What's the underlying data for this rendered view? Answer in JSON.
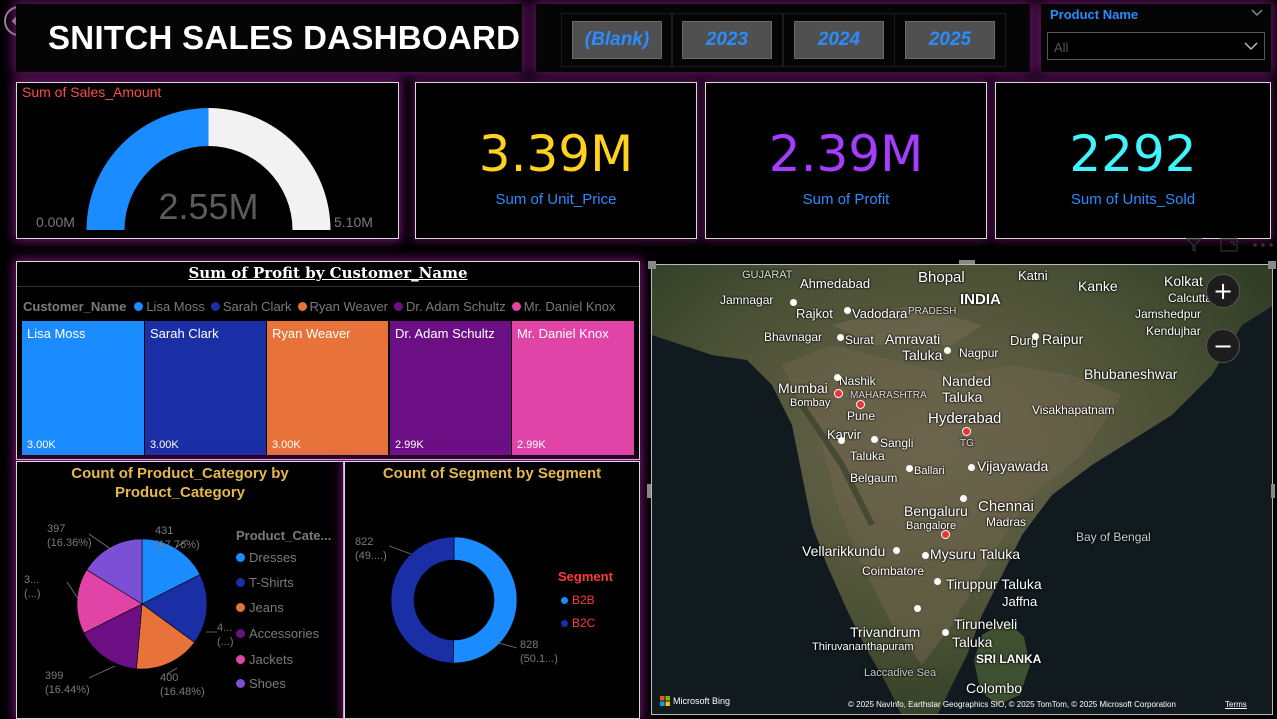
{
  "header": {
    "title": "SNITCH SALES DASHBOARD"
  },
  "year_slicer": {
    "options": [
      "(Blank)",
      "2023",
      "2024",
      "2025"
    ]
  },
  "product_slicer": {
    "label": "Product Name",
    "selected": "All"
  },
  "gauge": {
    "title": "Sum of Sales_Amount",
    "value_label": "2.55M",
    "min_label": "0.00M",
    "max_label": "5.10M",
    "value": 2.55,
    "min": 0,
    "max": 5.1,
    "fill_color": "#1a8cff",
    "track_color": "#f2f2f2"
  },
  "kpis": [
    {
      "value": "3.39M",
      "label": "Sum of Unit_Price",
      "color": "#ffd21f"
    },
    {
      "value": "2.39M",
      "label": "Sum of Profit",
      "color": "#a53dff"
    },
    {
      "value": "2292",
      "label": "Sum of Units_Sold",
      "color": "#3ff3ff"
    }
  ],
  "treemap": {
    "title": "Sum of Profit by Customer_Name",
    "legend_title": "Customer_Name",
    "items": [
      {
        "name": "Lisa Moss",
        "value_label": "3.00K",
        "value": 3.0,
        "color": "#1a8cff"
      },
      {
        "name": "Sarah Clark",
        "value_label": "3.00K",
        "value": 3.0,
        "color": "#1a2ea6"
      },
      {
        "name": "Ryan Weaver",
        "value_label": "3.00K",
        "value": 3.0,
        "color": "#e8733a"
      },
      {
        "name": "Dr. Adam Schultz",
        "value_label": "2.99K",
        "value": 2.99,
        "color": "#6c0f85"
      },
      {
        "name": "Mr. Daniel Knox",
        "value_label": "2.99K",
        "value": 2.99,
        "color": "#e044a7"
      }
    ]
  },
  "chart_data": [
    {
      "type": "pie",
      "title": "Count of Product_Category by Product_Category",
      "legend_title": "Product_Cate...",
      "categories": [
        "Dresses",
        "T-Shirts",
        "Jeans",
        "Accessories",
        "Jackets",
        "Shoes"
      ],
      "values": [
        431,
        430,
        400,
        399,
        398,
        397
      ],
      "colors": [
        "#1a8cff",
        "#1a2ea6",
        "#e8733a",
        "#6c0f85",
        "#e044a7",
        "#7b4fd6"
      ],
      "data_labels": [
        {
          "value": "431",
          "pct": "(17.76%)"
        },
        {
          "value": "4...",
          "pct": "(...)"
        },
        {
          "value": "400",
          "pct": "(16.48%)"
        },
        {
          "value": "399",
          "pct": "(16.44%)"
        },
        {
          "value": "3...",
          "pct": "(...)"
        },
        {
          "value": "397",
          "pct": "(16.36%)"
        }
      ]
    },
    {
      "type": "pie",
      "title": "Count of Segment by Segment",
      "legend_title": "Segment",
      "categories": [
        "B2B",
        "B2C"
      ],
      "values": [
        828,
        822
      ],
      "colors": [
        "#1a8cff",
        "#1a2ea6"
      ],
      "data_labels": [
        {
          "value": "828",
          "pct": "(50.1...)"
        },
        {
          "value": "822",
          "pct": "(49....)"
        }
      ]
    }
  ],
  "map": {
    "cities": [
      {
        "name": "Bhopal"
      },
      {
        "name": "Katni"
      },
      {
        "name": "Kolkat"
      },
      {
        "name": "GUJARAT"
      },
      {
        "name": "Ahmedabad"
      },
      {
        "name": "INDIA"
      },
      {
        "name": "Kanke"
      },
      {
        "name": "Calcutta"
      },
      {
        "name": "Jamnagar"
      },
      {
        "name": "Rajkot"
      },
      {
        "name": "Vadodara"
      },
      {
        "name": "PRADESH"
      },
      {
        "name": "Jamshedpur"
      },
      {
        "name": "Kendujhar"
      },
      {
        "name": "Bhavnagar"
      },
      {
        "name": "Surat"
      },
      {
        "name": "Amravati"
      },
      {
        "name": "Durg"
      },
      {
        "name": "Raipur"
      },
      {
        "name": "Taluka"
      },
      {
        "name": "Nagpur"
      },
      {
        "name": "Bhubaneshwar"
      },
      {
        "name": "Nashik"
      },
      {
        "name": "Mumbai"
      },
      {
        "name": "Bombay"
      },
      {
        "name": "MAHARASHTRA"
      },
      {
        "name": "Nanded"
      },
      {
        "name": "Taluka"
      },
      {
        "name": "Pune"
      },
      {
        "name": "Visakhapatnam"
      },
      {
        "name": "Hyderabad"
      },
      {
        "name": "Karvir"
      },
      {
        "name": "Sangli"
      },
      {
        "name": "TG"
      },
      {
        "name": "Taluka"
      },
      {
        "name": "Vijayawada"
      },
      {
        "name": "Ballari"
      },
      {
        "name": "Belgaum"
      },
      {
        "name": "Chennai"
      },
      {
        "name": "Bengaluru"
      },
      {
        "name": "Madras"
      },
      {
        "name": "Bay of Bengal"
      },
      {
        "name": "Bangalore"
      },
      {
        "name": "Vellarikkundu"
      },
      {
        "name": "Mysuru Taluka"
      },
      {
        "name": "Coimbatore"
      },
      {
        "name": "Tiruppur Taluka"
      },
      {
        "name": "Jaffna"
      },
      {
        "name": "Tirunelveli"
      },
      {
        "name": "Trivandrum"
      },
      {
        "name": "Taluka"
      },
      {
        "name": "Thiruvananthapuram"
      },
      {
        "name": "SRI LANKA"
      },
      {
        "name": "Laccadive Sea"
      },
      {
        "name": "Colombo"
      }
    ],
    "attribution": "© 2025 NavInfo, Earthstar Geographics SIO, © 2025 TomTom, © 2025 Microsoft Corporation",
    "terms": "Terms",
    "bing": "Microsoft Bing",
    "zoom_in": "+",
    "zoom_out": "−"
  }
}
